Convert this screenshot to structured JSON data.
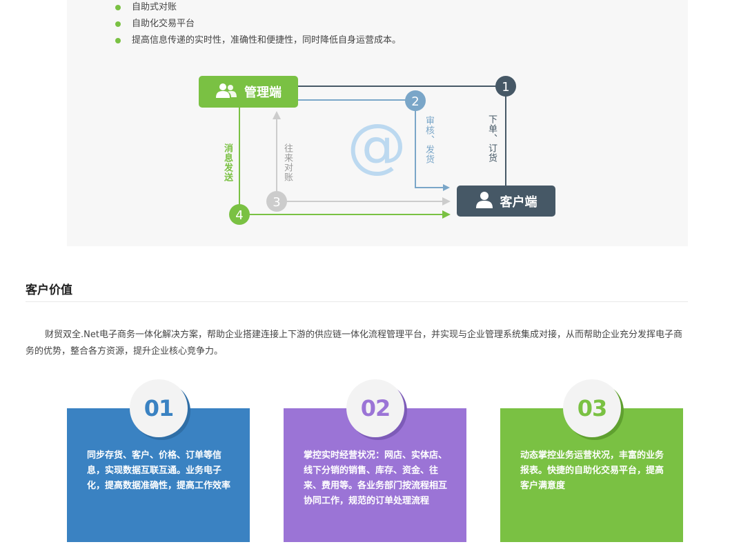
{
  "bullets": [
    "自助式对账",
    "自助化交易平台",
    "提高信息传递的实时性，准确性和便捷性，同时降低自身运营成本。"
  ],
  "diagram": {
    "manager_label": "管理端",
    "client_label": "客户端",
    "at_symbol": "@",
    "steps": [
      "1",
      "2",
      "3",
      "4"
    ],
    "label_order": "下单、订货",
    "label_review": "审核、发货",
    "label_accounts": "往来对账",
    "label_message": "消息发送",
    "colors": {
      "green": "#7ac143",
      "dark": "#465866",
      "blue": "#7aa6c8",
      "gray": "#cccccc",
      "at": "#bcd9f0"
    }
  },
  "section": {
    "title": "客户价值",
    "intro": "财贸双全.Net电子商务一体化解决方案，帮助企业搭建连接上下游的供应链一体化流程管理平台，并实现与企业管理系统集成对接，从而帮助企业充分发挥电子商务的优势，整合各方资源，提升企业核心竞争力。"
  },
  "cards": [
    {
      "num": "01",
      "color": "#3a82c2",
      "text": "同步存货、客户、价格、订单等信息，实现数据互联互通。业务电子化，提高数据准确性，提高工作效率"
    },
    {
      "num": "02",
      "color": "#9b74d6",
      "text": "掌控实时经营状况：网店、实体店、线下分销的销售、库存、资金、往来、费用等。各业务部门按流程相互协同工作，规范的订单处理流程"
    },
    {
      "num": "03",
      "color": "#7ac143",
      "text": "动态掌控业务运营状况，丰富的业务报表。快捷的自助化交易平台，提高客户满意度"
    }
  ]
}
